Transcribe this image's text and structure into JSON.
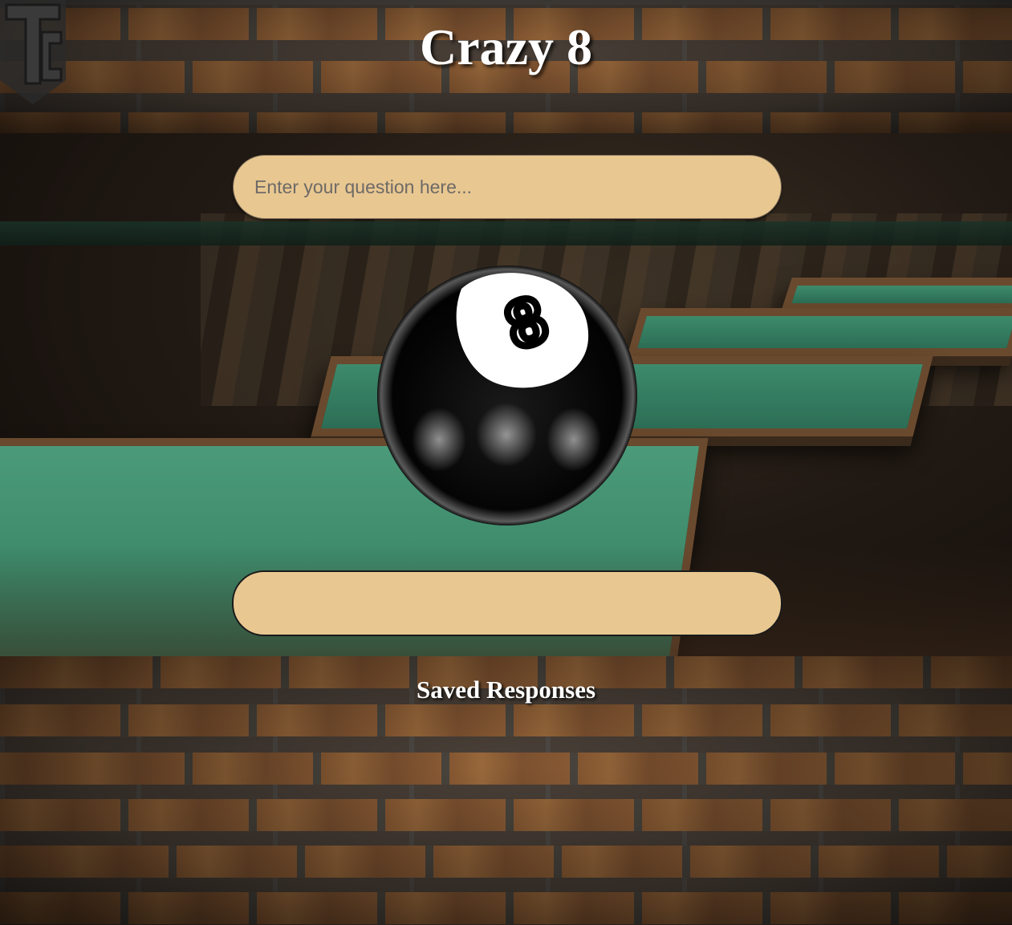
{
  "header": {
    "title": "Crazy 8",
    "logo_icon": "tc-shield-logo-icon"
  },
  "question": {
    "placeholder": "Enter your question here...",
    "value": ""
  },
  "ball": {
    "icon": "eight-ball-icon",
    "number": "8"
  },
  "answer": {
    "text": ""
  },
  "saved": {
    "heading": "Saved Responses",
    "items": []
  },
  "colors": {
    "input_fill": "#e8c791",
    "title_text": "#ffffff",
    "ball": "#000000"
  }
}
